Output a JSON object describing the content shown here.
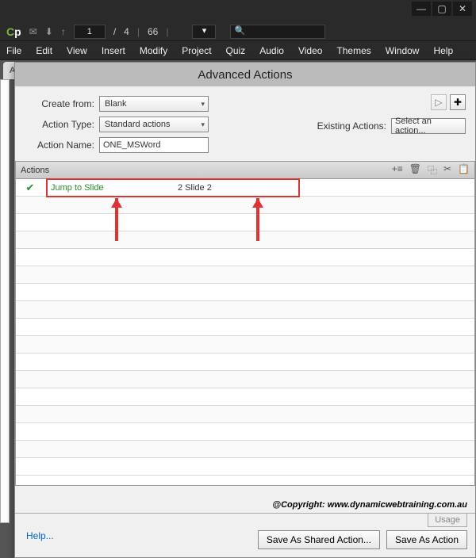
{
  "window": {
    "min": "—",
    "max": "▢",
    "close": "✕"
  },
  "toolbar": {
    "page_current": "1",
    "page_sep": "/",
    "page_total": "4",
    "zoom": "66",
    "search_icon": "🔍"
  },
  "menubar": [
    "File",
    "Edit",
    "View",
    "Insert",
    "Modify",
    "Project",
    "Quiz",
    "Audio",
    "Video",
    "Themes",
    "Window",
    "Help"
  ],
  "tab": {
    "label": "AdvancedActions.cptx*",
    "close": "×"
  },
  "dialog": {
    "title": "Advanced Actions",
    "create_from_label": "Create from:",
    "create_from_value": "Blank",
    "action_type_label": "Action Type:",
    "action_type_value": "Standard actions",
    "action_name_label": "Action Name:",
    "action_name_value": "ONE_MSWord",
    "existing_label": "Existing Actions:",
    "existing_value": "Select an action...",
    "panel_label": "Actions",
    "icons": {
      "add": "+≡",
      "delete": "🗑",
      "copy": "⿻",
      "cut": "✂",
      "paste": "📋"
    },
    "row": {
      "check": "✔",
      "action": "Jump to Slide",
      "target": "2 Slide 2"
    },
    "copyright": "@Copyright: www.dynamicwebtraining.com.au",
    "help": "Help...",
    "usage": "Usage",
    "save_shared": "Save As Shared Action...",
    "save_action": "Save As Action"
  }
}
